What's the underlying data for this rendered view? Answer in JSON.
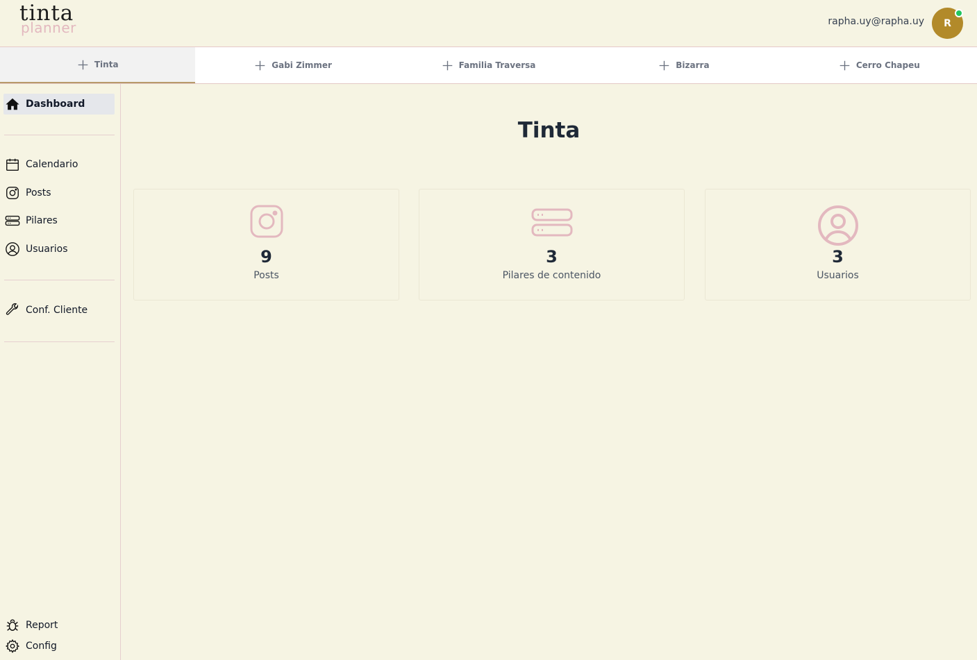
{
  "app": {
    "logo_top": "tinta",
    "logo_bottom": "planner"
  },
  "user": {
    "email": "rapha.uy@rapha.uy",
    "avatar_initial": "R",
    "status_color": "#22c55e"
  },
  "tabs": [
    {
      "label": "Tinta",
      "active": true
    },
    {
      "label": "Gabi Zimmer",
      "active": false
    },
    {
      "label": "Familia Traversa",
      "active": false
    },
    {
      "label": "Bizarra",
      "active": false
    },
    {
      "label": "Cerro Chapeu",
      "active": false
    }
  ],
  "sidebar": {
    "items": [
      {
        "label": "Dashboard",
        "icon": "home-icon",
        "active": true
      },
      {
        "label": "Calendario",
        "icon": "calendar-icon"
      },
      {
        "label": "Posts",
        "icon": "instagram-icon"
      },
      {
        "label": "Pilares",
        "icon": "server-icon"
      },
      {
        "label": "Usuarios",
        "icon": "user-circle-icon"
      },
      {
        "label": "Conf. Cliente",
        "icon": "wrench-icon"
      }
    ],
    "bottom_items": [
      {
        "label": "Report",
        "icon": "bug-icon"
      },
      {
        "label": "Config",
        "icon": "gear-icon"
      }
    ]
  },
  "main": {
    "title": "Tinta",
    "cards": [
      {
        "value": "9",
        "label": "Posts",
        "icon": "instagram-icon"
      },
      {
        "value": "3",
        "label": "Pilares de contenido",
        "icon": "server-icon"
      },
      {
        "value": "3",
        "label": "Usuarios",
        "icon": "user-circle-icon"
      }
    ]
  },
  "colors": {
    "background": "#f6f4e3",
    "accent_pink": "#e3b8bf",
    "avatar_bg": "#b28a2a"
  }
}
